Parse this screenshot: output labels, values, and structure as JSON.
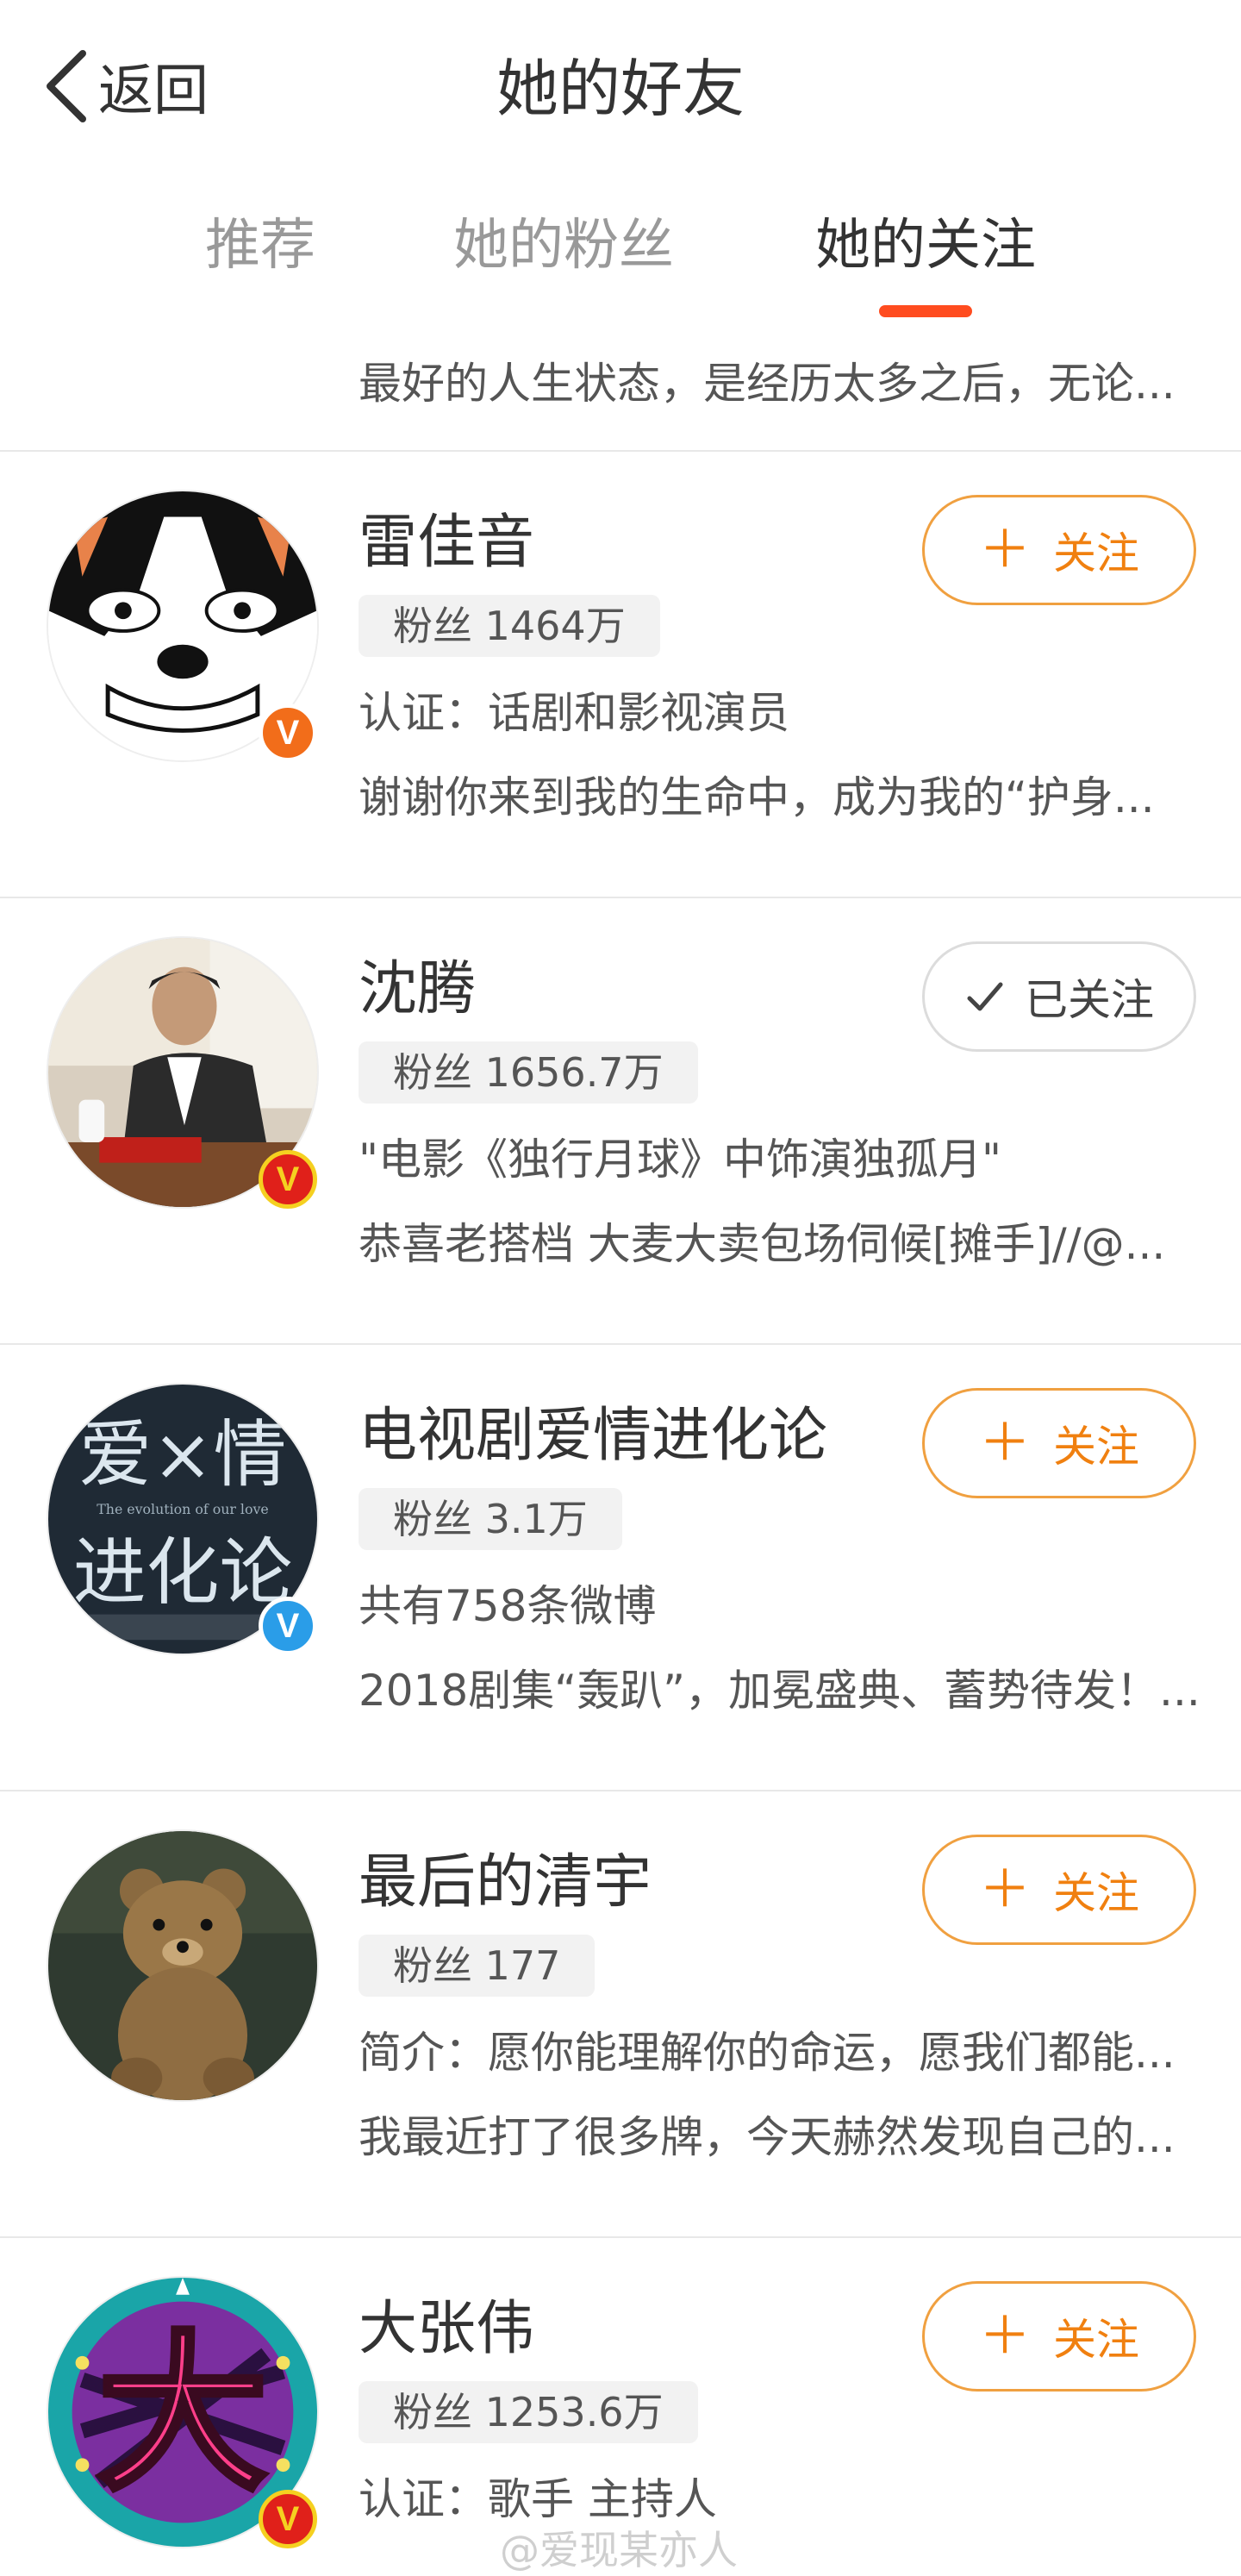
{
  "header": {
    "back_label": "返回",
    "title": "她的好友"
  },
  "tabs": [
    {
      "label": "推荐",
      "active": false
    },
    {
      "label": "她的粉丝",
      "active": false
    },
    {
      "label": "她的关注",
      "active": true
    }
  ],
  "top_snippet": "最好的人生状态，是经历太多之后，无论...",
  "users": [
    {
      "name": "雷佳音",
      "fans": "粉丝 1464万",
      "line1": "认证：话剧和影视演员",
      "line2": "谢谢你来到我的生命中，成为我的“护身...",
      "badge_color": "#f26d1a",
      "follow_label": "关注",
      "followed": false
    },
    {
      "name": "沈腾",
      "fans": "粉丝 1656.7万",
      "line1": "\"电影《独行月球》中饰演独孤月\"",
      "line2": "恭喜老搭档 大麦大卖包场伺候[摊手]//@...",
      "badge_color": "#e0201a",
      "follow_label": "已关注",
      "followed": true
    },
    {
      "name": "电视剧爱情进化论",
      "fans": "粉丝 3.1万",
      "line1": "共有758条微博",
      "line2": "2018剧集“轰趴”，加冕盛典、蓄势待发！...",
      "badge_color": "#2a9de8",
      "follow_label": "关注",
      "followed": false
    },
    {
      "name": "最后的清宇",
      "fans": "粉丝 177",
      "line1": "简介：愿你能理解你的命运，愿我们都能...",
      "line2": "我最近打了很多牌，今天赫然发现自己的...",
      "badge_color": "",
      "follow_label": "关注",
      "followed": false
    },
    {
      "name": "大张伟",
      "fans": "粉丝 1253.6万",
      "line1": "认证：歌手 主持人",
      "line2": "",
      "badge_color": "#e0201a",
      "follow_label": "关注",
      "followed": false
    }
  ],
  "badge_letter": "V",
  "avatar_text": {
    "user3_title": "爱×情",
    "user3_subtitle": "The evolution of our love",
    "user3_bottom": "进化论",
    "user5_char": "大"
  },
  "watermark": "@爱现某亦人"
}
